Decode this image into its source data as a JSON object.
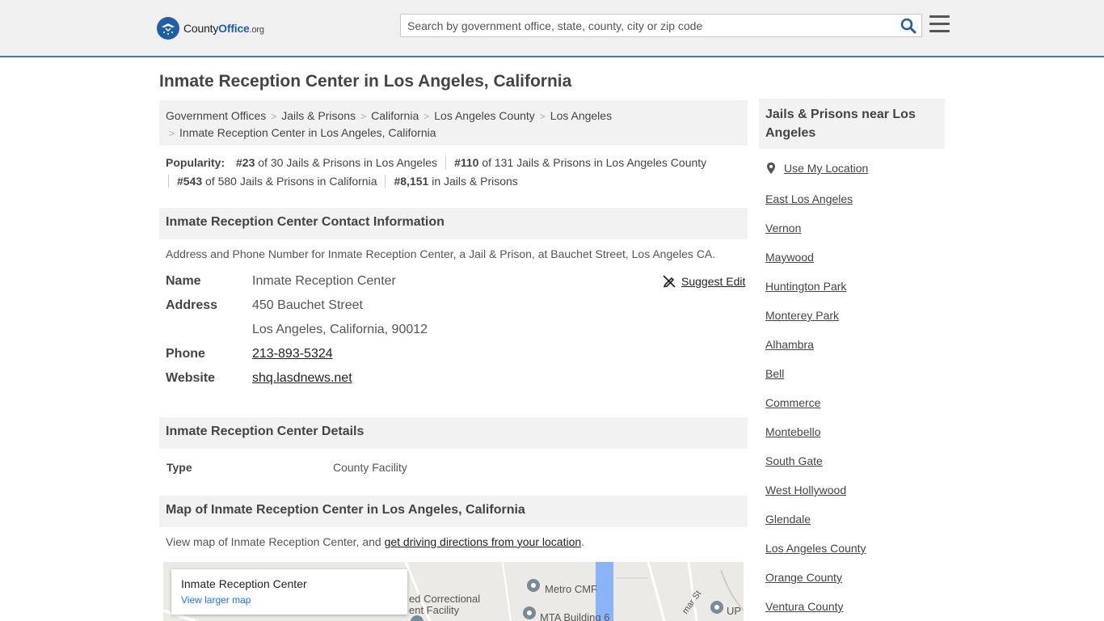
{
  "header": {
    "logo_word_county": "County",
    "logo_word_office": "Office",
    "logo_word_org": ".org",
    "search_placeholder": "Search by government office, state, county, city or zip code"
  },
  "page_title": "Inmate Reception Center in Los Angeles, California",
  "breadcrumb": {
    "items": [
      "Government Offices",
      "Jails & Prisons",
      "California",
      "Los Angeles County",
      "Los Angeles"
    ],
    "current": "Inmate Reception Center in Los Angeles, California"
  },
  "popularity": {
    "label": "Popularity:",
    "items": [
      {
        "rank": "#23",
        "text": " of 30 Jails & Prisons in Los Angeles"
      },
      {
        "rank": "#110",
        "text": " of 131 Jails & Prisons in Los Angeles County"
      },
      {
        "rank": "#543",
        "text": " of 580 Jails & Prisons in California"
      },
      {
        "rank": "#8,151",
        "text": " in Jails & Prisons"
      }
    ]
  },
  "contact": {
    "heading": "Inmate Reception Center Contact Information",
    "description": "Address and Phone Number for Inmate Reception Center, a Jail & Prison, at Bauchet Street, Los Angeles CA.",
    "suggest_edit": "Suggest Edit",
    "name_label": "Name",
    "name": "Inmate Reception Center",
    "address_label": "Address",
    "address_line1": "450 Bauchet Street",
    "address_line2": "Los Angeles, California, 90012",
    "phone_label": "Phone",
    "phone": "213-893-5324",
    "website_label": "Website",
    "website": "shq.lasdnews.net"
  },
  "details": {
    "heading": "Inmate Reception Center Details",
    "type_label": "Type",
    "type_value": "County Facility"
  },
  "map": {
    "heading": "Map of Inmate Reception Center in Los Angeles, California",
    "desc_prefix": "View map of Inmate Reception Center, and ",
    "desc_link": "get driving directions from your location",
    "desc_suffix": ".",
    "card_title": "Inmate Reception Center",
    "card_link": "View larger map",
    "labels": [
      "ed Correctional",
      "ent Facility",
      "Metro CMF",
      "MTA Building 6",
      "UP",
      "mar St"
    ]
  },
  "sidebar": {
    "heading": "Jails & Prisons near Los Angeles",
    "use_location": "Use My Location",
    "items": [
      "East Los Angeles",
      "Vernon",
      "Maywood",
      "Huntington Park",
      "Monterey Park",
      "Alhambra",
      "Bell",
      "Commerce",
      "Montebello",
      "South Gate",
      "West Hollywood",
      "Glendale",
      "Los Angeles County",
      "Orange County",
      "Ventura County"
    ]
  }
}
